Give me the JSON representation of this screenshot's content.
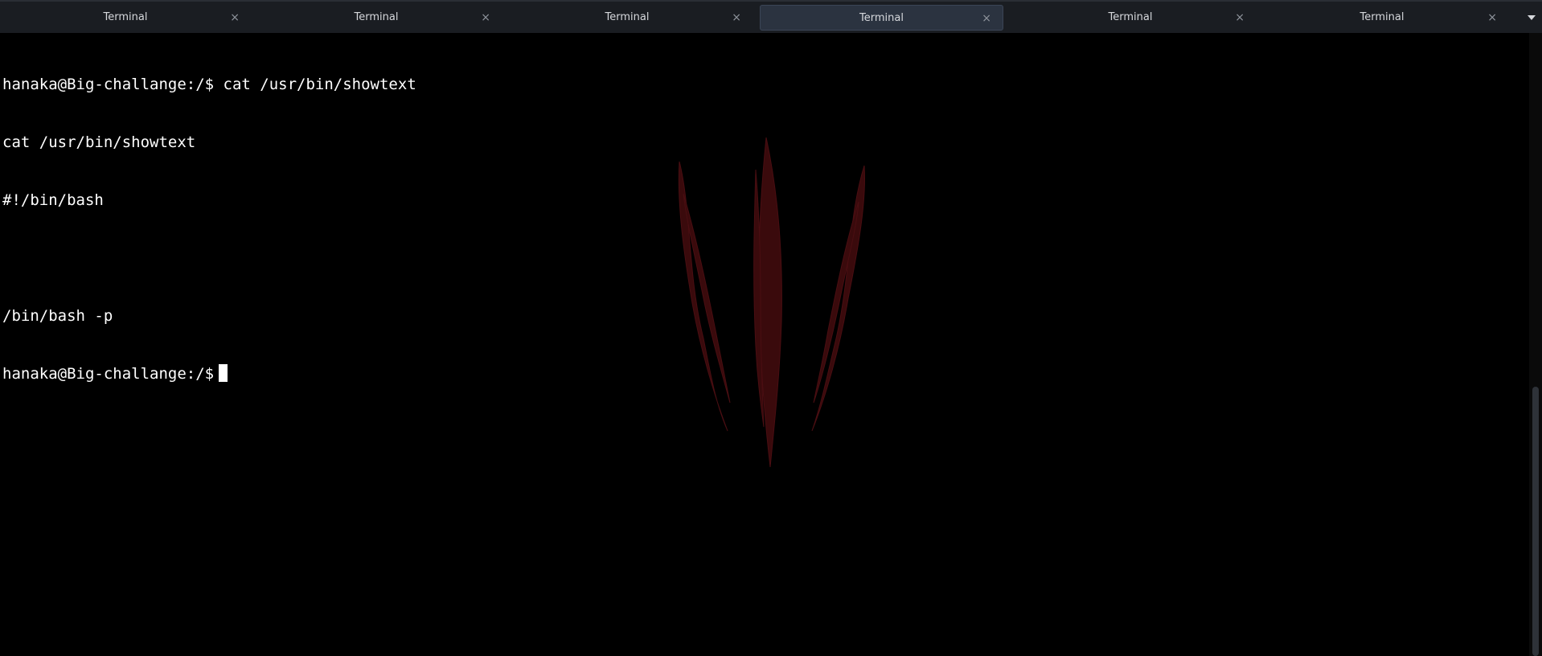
{
  "tabbar": {
    "tabs": [
      {
        "label": "Terminal",
        "close": "×",
        "active": false
      },
      {
        "label": "Terminal",
        "close": "×",
        "active": false
      },
      {
        "label": "Terminal",
        "close": "×",
        "active": false
      },
      {
        "label": "Terminal",
        "close": "×",
        "active": true
      },
      {
        "label": "Terminal",
        "close": "×",
        "active": false
      },
      {
        "label": "Terminal",
        "close": "×",
        "active": false
      }
    ]
  },
  "terminal": {
    "lines": [
      "hanaka@Big-challange:/$ cat /usr/bin/showtext",
      "cat /usr/bin/showtext",
      "#!/bin/bash",
      "",
      "/bin/bash -p",
      "hanaka@Big-challange:/$"
    ]
  },
  "colors": {
    "background": "#000000",
    "tabbar": "#1a1d22",
    "active_tab": "#2b3340",
    "text": "#ffffff",
    "wallpaper_accent": "#3a0a0c"
  }
}
